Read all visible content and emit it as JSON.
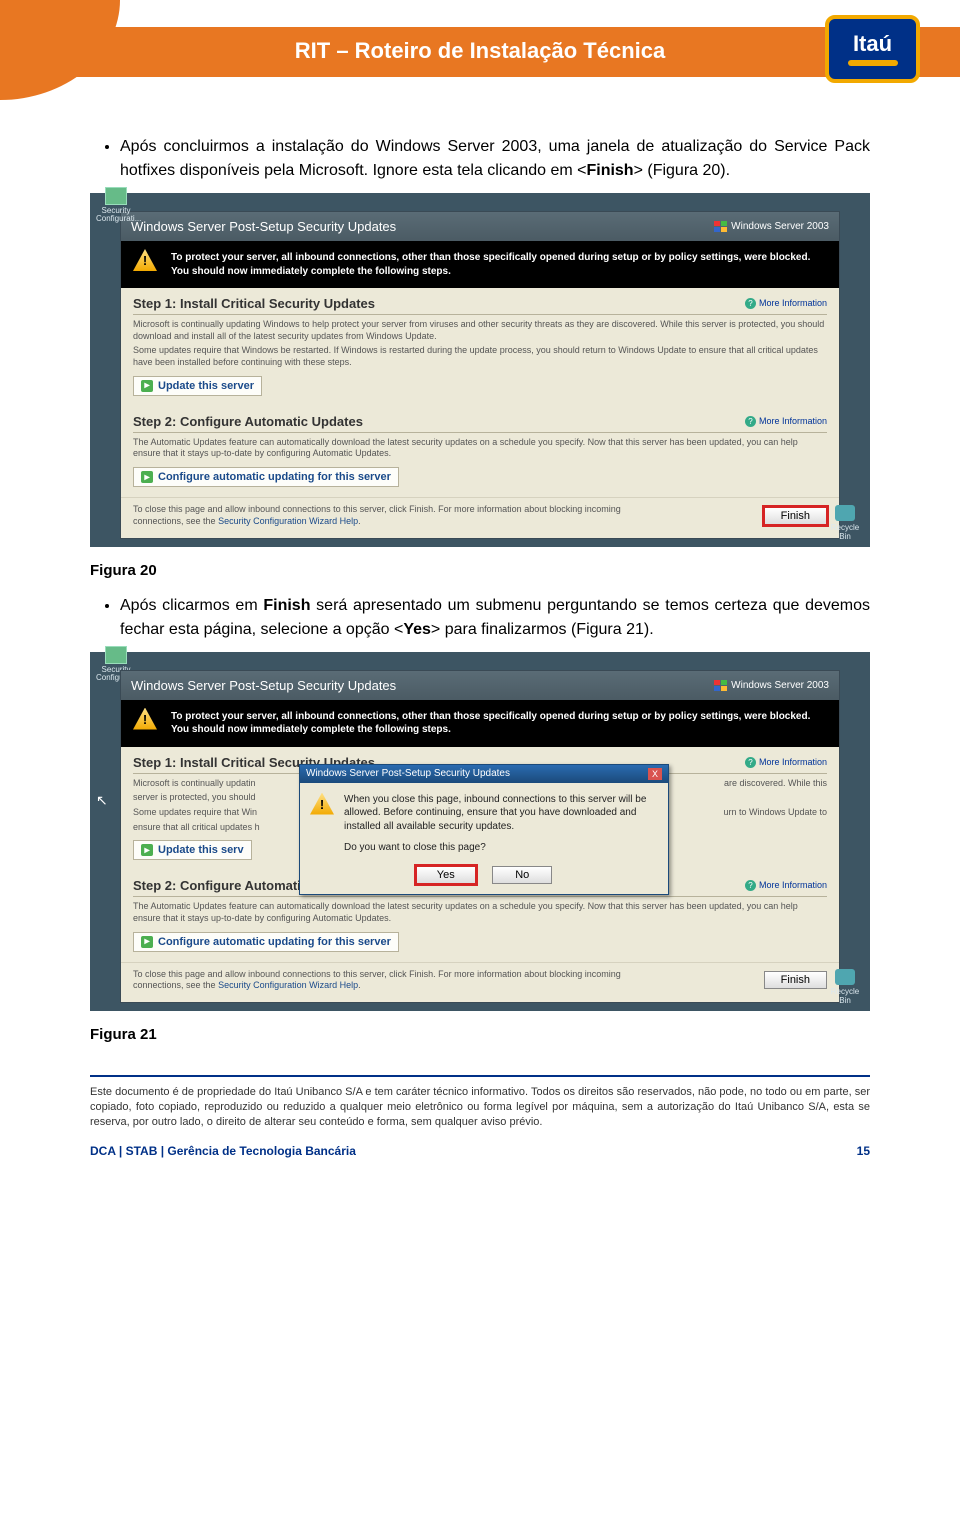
{
  "header": {
    "doc_title": "RIT – Roteiro de Instalação Técnica",
    "logo_text": "Itaú"
  },
  "para1": {
    "t1": "Após concluirmos a instalação do Windows Server 2003, uma janela de atualização do Service Pack hotfixes disponíveis pela Microsoft. Ignore esta tela clicando em <",
    "bold1": "Finish",
    "t2": "> (Figura 20)."
  },
  "fig20": "Figura 20",
  "para2": {
    "t1": "Após clicarmos em ",
    "bold1": "Finish",
    "t2": " será apresentado um submenu perguntando se temos certeza que devemos fechar esta página, selecione a opção <",
    "bold2": "Yes",
    "t3": "> para finalizarmos (Figura 21)."
  },
  "fig21": "Figura 21",
  "screenshot": {
    "sec_icon": "Security Configurati...",
    "recycle": "Recycle Bin",
    "window_title": "Windows Server Post-Setup Security Updates",
    "win_brand": "Windows Server 2003",
    "banner": "To protect your server, all inbound connections, other than those specifically opened during setup or by policy settings, were blocked. You should now immediately complete the following steps.",
    "step1_title": "Step 1: Install Critical Security Updates",
    "more_info": "More Information",
    "step1_p1": "Microsoft is continually updating Windows to help protect your server from viruses and other security threats as they are discovered. While this server is protected, you should download and install all of the latest security updates from Windows Update.",
    "step1_p2": "Some updates require that Windows be restarted. If Windows is restarted during the update process, you should return to Windows Update to ensure that all critical updates have been installed before continuing with these steps.",
    "step1_btn": "Update this server",
    "step2_title": "Step 2: Configure Automatic Updates",
    "step2_p1": "The Automatic Updates feature can automatically download the latest security updates on a schedule you specify. Now that this server has been updated, you can help ensure that it stays up-to-date by configuring Automatic Updates.",
    "step2_btn": "Configure automatic updating for this server",
    "foot_p": "To close this page and allow inbound connections to this server, click Finish. For more information about blocking incoming connections, see the ",
    "foot_link": "Security Configuration Wizard Help",
    "finish": "Finish"
  },
  "dialog": {
    "title": "Windows Server Post-Setup Security Updates",
    "body_l1": "When you close this page, inbound connections to this server will be allowed. Before continuing, ensure that you have downloaded and installed all available security updates.",
    "body_l2": "Do you want to close this page?",
    "yes": "Yes",
    "no": "No"
  },
  "shot2_trunc": {
    "s1p1": "Microsoft is continually updatin",
    "s1p1b": "are discovered. While this",
    "s1p2a": "server is protected, you should",
    "s1p3a": "Some updates require that Win",
    "s1p3b": "urn to Windows Update to",
    "s1p4a": "ensure that all critical updates h",
    "btn1": "Update this serv"
  },
  "footer": {
    "disclaimer": "Este documento é de propriedade do Itaú Unibanco S/A e tem caráter técnico informativo. Todos os direitos são reservados, não pode, no todo ou em parte, ser copiado, foto copiado, reproduzido ou reduzido a qualquer meio eletrônico ou forma legível por máquina, sem a autorização do Itaú Unibanco S/A, esta se reserva, por outro lado, o direito de alterar seu conteúdo e forma, sem qualquer aviso prévio.",
    "left": "DCA | STAB | Gerência de Tecnologia Bancária",
    "right": "15"
  }
}
